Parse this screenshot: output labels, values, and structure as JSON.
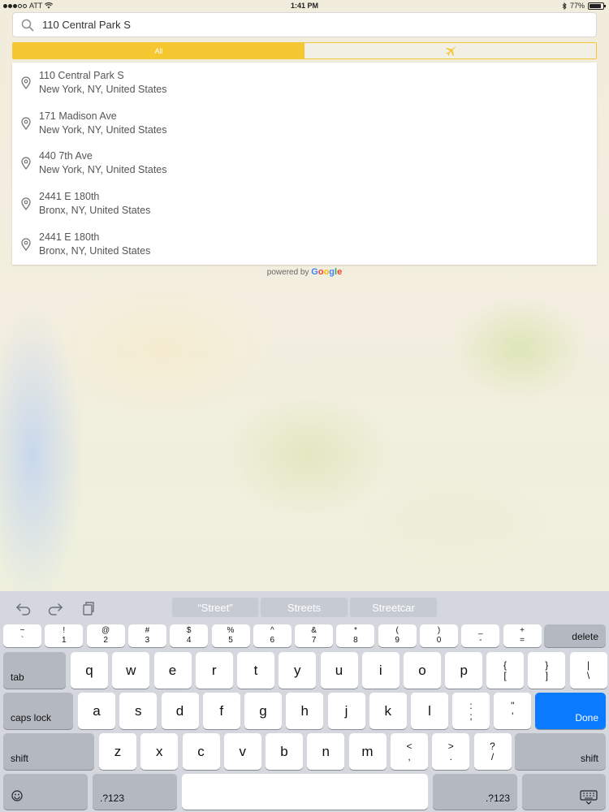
{
  "status_bar": {
    "carrier": "ATT",
    "time": "1:41 PM",
    "battery_text": "77%",
    "battery_level": 0.77,
    "icons": [
      "signal-icon",
      "wifi-icon",
      "bluetooth-icon",
      "battery-icon"
    ]
  },
  "search": {
    "value": "110 Central Park S",
    "icon": "search-icon"
  },
  "segment": {
    "all_label": "All",
    "airport_icon": "airplane-icon",
    "accent_color": "#f5c731"
  },
  "results": [
    {
      "line1": "110 Central Park S",
      "line2": "New York, NY, United States"
    },
    {
      "line1": "171 Madison Ave",
      "line2": "New York, NY, United States"
    },
    {
      "line1": "440 7th Ave",
      "line2": "New York, NY, United States"
    },
    {
      "line1": "2441 E 180th",
      "line2": "Bronx, NY, United States"
    },
    {
      "line1": "2441 E 180th",
      "line2": "Bronx, NY, United States"
    }
  ],
  "powered_by": {
    "prefix": "powered by",
    "brand": [
      "G",
      "o",
      "o",
      "g",
      "l",
      "e"
    ]
  },
  "keyboard": {
    "suggestions": [
      "“Street”",
      "Streets",
      "Streetcar"
    ],
    "toolbar_icons": [
      "undo-icon",
      "redo-icon",
      "paste-icon"
    ],
    "number_row": [
      {
        "top": "~",
        "bottom": "`"
      },
      {
        "top": "!",
        "bottom": "1"
      },
      {
        "top": "@",
        "bottom": "2"
      },
      {
        "top": "#",
        "bottom": "3"
      },
      {
        "top": "$",
        "bottom": "4"
      },
      {
        "top": "%",
        "bottom": "5"
      },
      {
        "top": "^",
        "bottom": "6"
      },
      {
        "top": "&",
        "bottom": "7"
      },
      {
        "top": "*",
        "bottom": "8"
      },
      {
        "top": "(",
        "bottom": "9"
      },
      {
        "top": ")",
        "bottom": "0"
      },
      {
        "top": "_",
        "bottom": "-"
      },
      {
        "top": "+",
        "bottom": "="
      }
    ],
    "delete_label": "delete",
    "tab_label": "tab",
    "row_q": [
      "q",
      "w",
      "e",
      "r",
      "t",
      "y",
      "u",
      "i",
      "o",
      "p"
    ],
    "row_q_extra": [
      {
        "top": "{",
        "bottom": "["
      },
      {
        "top": "}",
        "bottom": "]"
      },
      {
        "top": "|",
        "bottom": "\\"
      }
    ],
    "caps_label": "caps lock",
    "row_a": [
      "a",
      "s",
      "d",
      "f",
      "g",
      "h",
      "j",
      "k",
      "l"
    ],
    "row_a_extra": [
      {
        "top": ":",
        "bottom": ";"
      },
      {
        "top": "\"",
        "bottom": "'"
      }
    ],
    "done_label": "Done",
    "shift_label": "shift",
    "row_z": [
      "z",
      "x",
      "c",
      "v",
      "b",
      "n",
      "m"
    ],
    "row_z_extra": [
      {
        "top": "<",
        "bottom": ","
      },
      {
        "top": ">",
        "bottom": "."
      },
      {
        "top": "?",
        "bottom": "/"
      }
    ],
    "numeric_label": ".?123",
    "emoji_icon": "emoji-icon",
    "dismiss_icon": "keyboard-dismiss-icon",
    "done_color": "#0a7aff"
  }
}
